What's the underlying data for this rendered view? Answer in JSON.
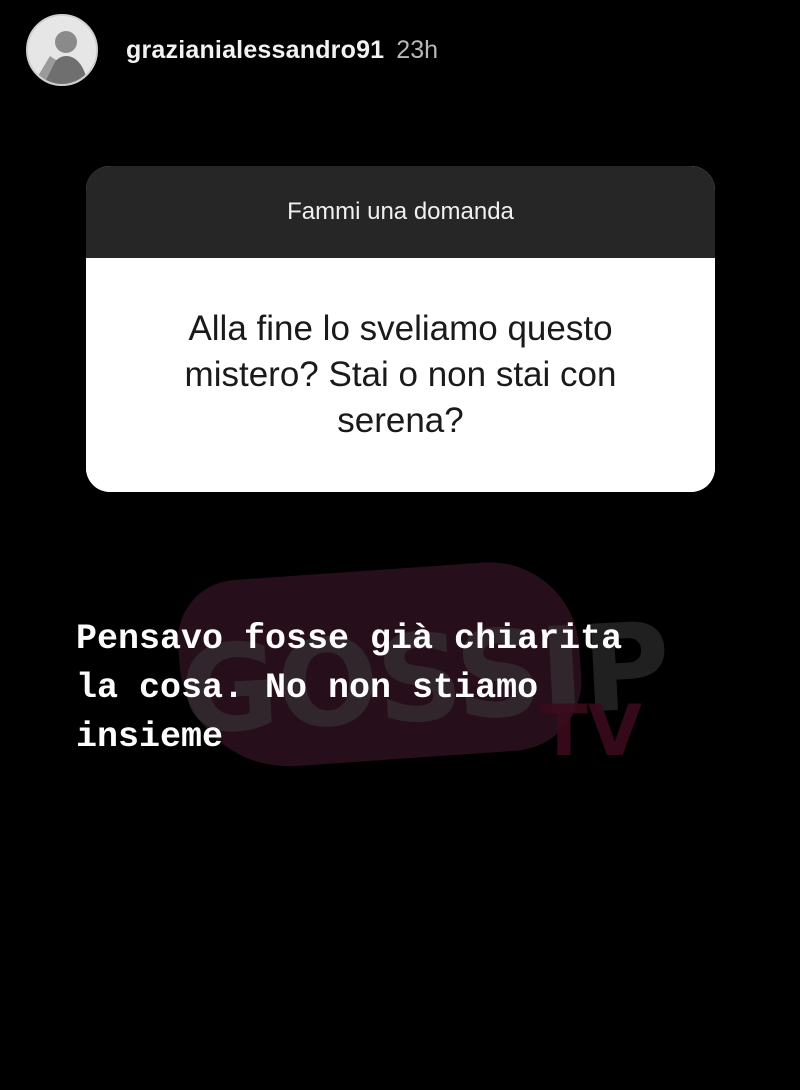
{
  "header": {
    "username": "grazianialessandro91",
    "timestamp": "23h"
  },
  "sticker": {
    "title": "Fammi una domanda",
    "question": "Alla fine lo sveliamo questo mistero? Stai o non stai con serena?"
  },
  "answer": {
    "text": "Pensavo fosse già chiarita\nla cosa. No non stiamo\ninsieme"
  },
  "watermark": {
    "text": "GOSSIP",
    "tv": "TV"
  },
  "colors": {
    "background": "#000000",
    "sticker_header": "#262626",
    "sticker_body": "#ffffff",
    "watermark_accent": "#2a0f1d"
  },
  "icons": {
    "avatar": "profile-photo"
  }
}
